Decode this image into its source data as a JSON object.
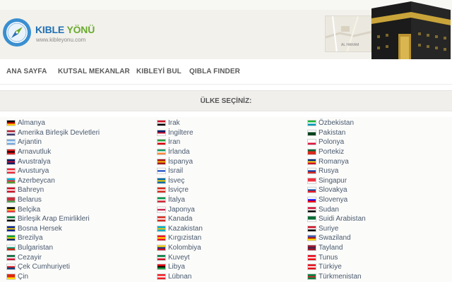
{
  "header": {
    "brand_part1": "KIBLE",
    "brand_part2": "YÖNÜ",
    "domain": "www.kibleyonu.com",
    "map_label": "AL HARAM"
  },
  "nav": {
    "items": [
      "ANA SAYFA",
      "KUTSAL MEKANLAR",
      "KIBLEYİ BUL",
      "QIBLA FINDER"
    ]
  },
  "section": {
    "title": "ÜLKE SEÇİNİZ:"
  },
  "countries": {
    "col1": [
      {
        "name": "Almanya",
        "flag": [
          "#000000",
          "#dd0000",
          "#ffce00"
        ]
      },
      {
        "name": "Amerika Birleşik Devletleri",
        "flag": [
          "#b22234",
          "#ffffff",
          "#3c3b6e"
        ]
      },
      {
        "name": "Arjantin",
        "flag": [
          "#74acdf",
          "#ffffff",
          "#74acdf"
        ]
      },
      {
        "name": "Arnavutluk",
        "flag": [
          "#e41e20",
          "#000000",
          "#e41e20"
        ]
      },
      {
        "name": "Avustralya",
        "flag": [
          "#012169",
          "#c8102e",
          "#012169"
        ]
      },
      {
        "name": "Avusturya",
        "flag": [
          "#ed2939",
          "#ffffff",
          "#ed2939"
        ]
      },
      {
        "name": "Azerbeycan",
        "flag": [
          "#00b5e2",
          "#ef3340",
          "#509e2f"
        ]
      },
      {
        "name": "Bahreyn",
        "flag": [
          "#ce1126",
          "#ffffff",
          "#ce1126"
        ]
      },
      {
        "name": "Belarus",
        "flag": [
          "#c8313e",
          "#c8313e",
          "#4aa657"
        ]
      },
      {
        "name": "Belçika",
        "flag": [
          "#000000",
          "#fdda24",
          "#ef3340"
        ]
      },
      {
        "name": "Birleşik Arap Emirlikleri",
        "flag": [
          "#00732f",
          "#ffffff",
          "#000000"
        ]
      },
      {
        "name": "Bosna Hersek",
        "flag": [
          "#002395",
          "#fecb00",
          "#002395"
        ]
      },
      {
        "name": "Brezilya",
        "flag": [
          "#009c3b",
          "#ffdf00",
          "#002776"
        ]
      },
      {
        "name": "Bulgaristan",
        "flag": [
          "#ffffff",
          "#00966e",
          "#d62612"
        ]
      },
      {
        "name": "Cezayir",
        "flag": [
          "#006233",
          "#ffffff",
          "#d21034"
        ]
      },
      {
        "name": "Çek Cumhuriyeti",
        "flag": [
          "#ffffff",
          "#d7141a",
          "#11457e"
        ]
      },
      {
        "name": "Çin",
        "flag": [
          "#de2910",
          "#de2910",
          "#ffde00"
        ]
      }
    ],
    "col2": [
      {
        "name": "Irak",
        "flag": [
          "#ce1126",
          "#ffffff",
          "#000000"
        ]
      },
      {
        "name": "İngiltere",
        "flag": [
          "#012169",
          "#c8102e",
          "#ffffff"
        ]
      },
      {
        "name": "İran",
        "flag": [
          "#239f40",
          "#ffffff",
          "#da0000"
        ]
      },
      {
        "name": "İrlanda",
        "flag": [
          "#169b62",
          "#ffffff",
          "#ff883e"
        ]
      },
      {
        "name": "İspanya",
        "flag": [
          "#aa151b",
          "#f1bf00",
          "#aa151b"
        ]
      },
      {
        "name": "İsrail",
        "flag": [
          "#ffffff",
          "#0038b8",
          "#ffffff"
        ]
      },
      {
        "name": "İsveç",
        "flag": [
          "#006aa7",
          "#fecc00",
          "#006aa7"
        ]
      },
      {
        "name": "İsviçre",
        "flag": [
          "#d52b1e",
          "#ffffff",
          "#d52b1e"
        ]
      },
      {
        "name": "İtalya",
        "flag": [
          "#009246",
          "#ffffff",
          "#ce2b37"
        ]
      },
      {
        "name": "Japonya",
        "flag": [
          "#ffffff",
          "#bc002d",
          "#ffffff"
        ]
      },
      {
        "name": "Kanada",
        "flag": [
          "#d52b1e",
          "#ffffff",
          "#d52b1e"
        ]
      },
      {
        "name": "Kazakistan",
        "flag": [
          "#00afca",
          "#fec50c",
          "#00afca"
        ]
      },
      {
        "name": "Kırgızistan",
        "flag": [
          "#e8112d",
          "#ffef00",
          "#e8112d"
        ]
      },
      {
        "name": "Kolombiya",
        "flag": [
          "#fcd116",
          "#003893",
          "#ce1126"
        ]
      },
      {
        "name": "Kuveyt",
        "flag": [
          "#007a3d",
          "#ffffff",
          "#ce1126"
        ]
      },
      {
        "name": "Libya",
        "flag": [
          "#e70013",
          "#000000",
          "#239e46"
        ]
      },
      {
        "name": "Lübnan",
        "flag": [
          "#ed1c24",
          "#ffffff",
          "#ed1c24"
        ]
      }
    ],
    "col3": [
      {
        "name": "Özbekistan",
        "flag": [
          "#1eb53a",
          "#ffffff",
          "#0099b5"
        ]
      },
      {
        "name": "Pakistan",
        "flag": [
          "#ffffff",
          "#01411c",
          "#01411c"
        ]
      },
      {
        "name": "Polonya",
        "flag": [
          "#ffffff",
          "#ffffff",
          "#dc143c"
        ]
      },
      {
        "name": "Portekiz",
        "flag": [
          "#046a38",
          "#da291c",
          "#da291c"
        ]
      },
      {
        "name": "Romanya",
        "flag": [
          "#002b7f",
          "#fcd116",
          "#ce1126"
        ]
      },
      {
        "name": "Rusya",
        "flag": [
          "#ffffff",
          "#0039a6",
          "#d52b1e"
        ]
      },
      {
        "name": "Singapur",
        "flag": [
          "#ef3340",
          "#ef3340",
          "#ffffff"
        ]
      },
      {
        "name": "Slovakya",
        "flag": [
          "#ffffff",
          "#0b4ea2",
          "#ee1c25"
        ]
      },
      {
        "name": "Slovenya",
        "flag": [
          "#ffffff",
          "#0000ff",
          "#ff0000"
        ]
      },
      {
        "name": "Sudan",
        "flag": [
          "#d21034",
          "#ffffff",
          "#000000"
        ]
      },
      {
        "name": "Suidi Arabistan",
        "flag": [
          "#006c35",
          "#006c35",
          "#ffffff"
        ]
      },
      {
        "name": "Suriye",
        "flag": [
          "#ce1126",
          "#ffffff",
          "#000000"
        ]
      },
      {
        "name": "Swaziland",
        "flag": [
          "#3e5eb9",
          "#b10c0c",
          "#ffd900"
        ]
      },
      {
        "name": "Tayland",
        "flag": [
          "#a51931",
          "#2d2a4a",
          "#a51931"
        ]
      },
      {
        "name": "Tunus",
        "flag": [
          "#e70013",
          "#ffffff",
          "#e70013"
        ]
      },
      {
        "name": "Türkiye",
        "flag": [
          "#e30a17",
          "#ffffff",
          "#e30a17"
        ]
      },
      {
        "name": "Türkmenistan",
        "flag": [
          "#00843d",
          "#d22630",
          "#00843d"
        ]
      }
    ]
  }
}
